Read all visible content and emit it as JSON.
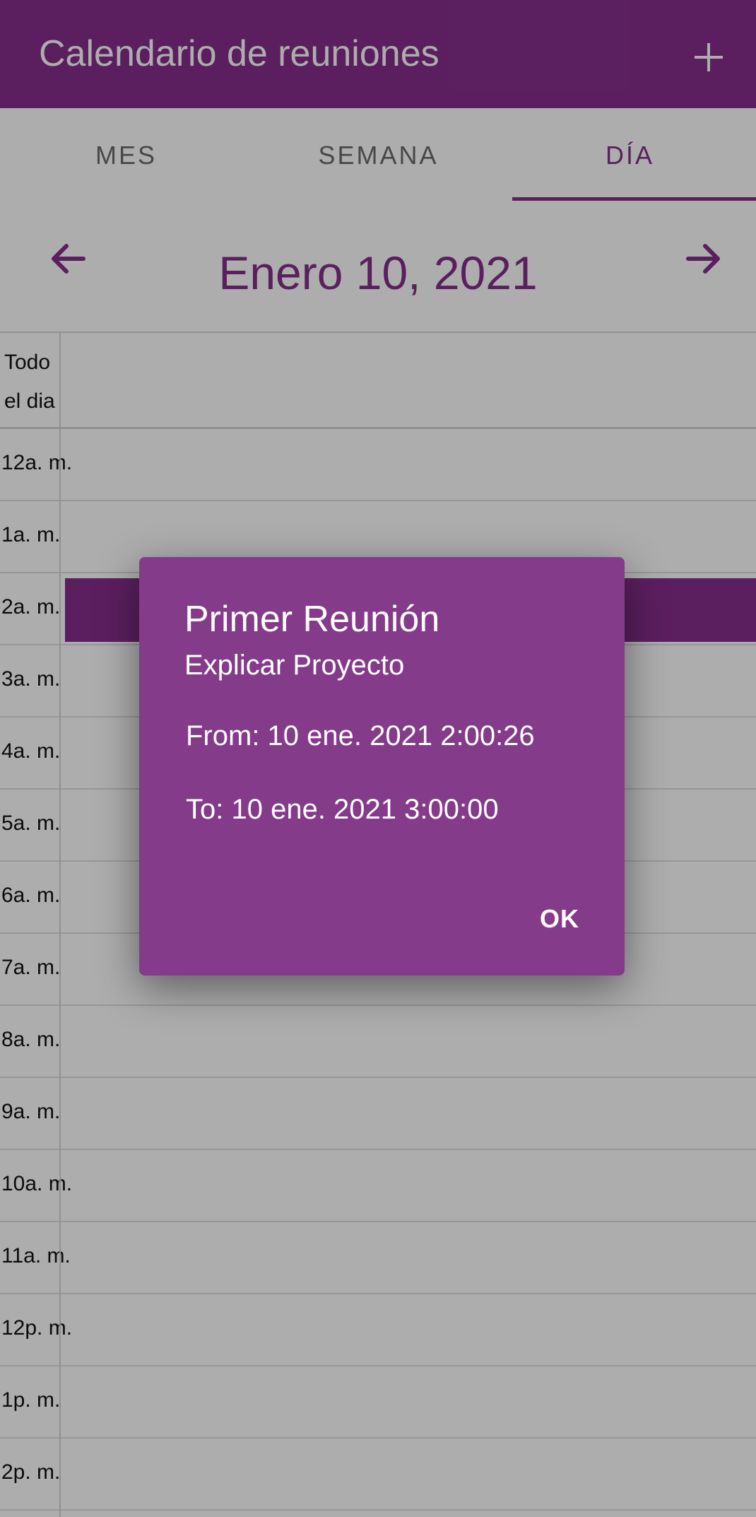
{
  "colors": {
    "primary": "#862f8d",
    "dialog": "#843b8a",
    "scrim": "rgba(0,0,0,0.32)"
  },
  "appbar": {
    "title": "Calendario de reuniones",
    "add_icon": "plus-icon"
  },
  "tabs": [
    {
      "label": "MES",
      "active": false
    },
    {
      "label": "SEMANA",
      "active": false
    },
    {
      "label": "DÍA",
      "active": true
    }
  ],
  "datenav": {
    "prev_icon": "arrow-left-icon",
    "next_icon": "arrow-right-icon",
    "date": "Enero 10, 2021"
  },
  "grid": {
    "allday_line1": "Todo",
    "allday_line2": "el dia",
    "hours": [
      "12a. m.",
      "1a. m.",
      "2a. m.",
      "3a. m.",
      "4a. m.",
      "5a. m.",
      "6a. m.",
      "7a. m.",
      "8a. m.",
      "9a. m.",
      "10a. m.",
      "11a. m.",
      "12p. m.",
      "1p. m.",
      "2p. m."
    ]
  },
  "dialog": {
    "title": "Primer Reunión",
    "subtitle": "Explicar Proyecto",
    "from": "From: 10 ene. 2021 2:00:26",
    "to": "To: 10 ene. 2021 3:00:00",
    "ok_label": "OK"
  }
}
